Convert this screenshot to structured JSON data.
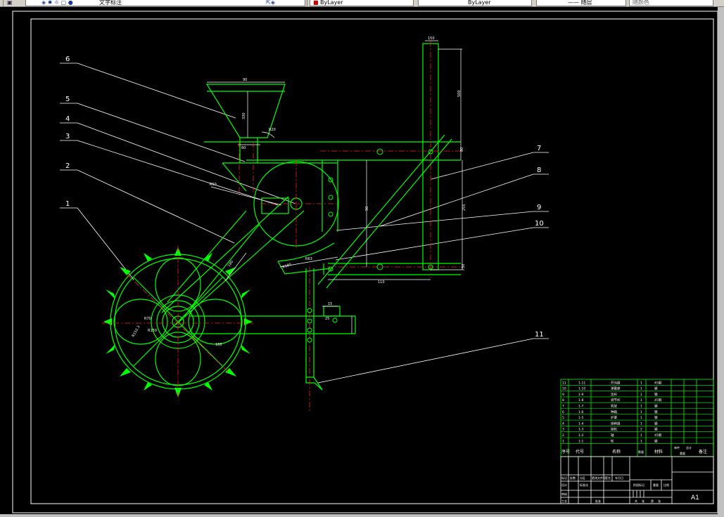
{
  "toolbar": {
    "layer_name": "文字标注",
    "layer_prefix": "0",
    "color_value": "ByLayer",
    "linetype_value": "ByLayer",
    "lineweight_value": "—— 随层",
    "plotstyle_value": "随颜色"
  },
  "drawing": {
    "callouts": [
      "6",
      "5",
      "4",
      "3",
      "2",
      "1",
      "7",
      "8",
      "9",
      "10",
      "11"
    ],
    "dimensions": [
      "90",
      "330",
      "60",
      "R20",
      "R50",
      "500",
      "150",
      "80",
      "50",
      "255",
      "110",
      "90",
      "15",
      "R63",
      "25",
      "R70",
      "R152.3",
      "160",
      "180",
      "R150",
      "R180"
    ],
    "sheet_size": "A1"
  },
  "bom": {
    "rows": [
      {
        "no": "11",
        "code": "1-11",
        "name": "开沟器",
        "qty": "1",
        "material": "45钢"
      },
      {
        "no": "10",
        "code": "1-10",
        "name": "弹簧座",
        "qty": "1",
        "material": "钢"
      },
      {
        "no": "9",
        "code": "1-9",
        "name": "连杆",
        "qty": "1",
        "material": "钢"
      },
      {
        "no": "8",
        "code": "1-8",
        "name": "调节杆",
        "qty": "1",
        "material": "45钢"
      },
      {
        "no": "7",
        "code": "1-7",
        "name": "机架",
        "qty": "1",
        "material": "钢"
      },
      {
        "no": "6",
        "code": "1-6",
        "name": "种箱",
        "qty": "1",
        "material": "钢"
      },
      {
        "no": "5",
        "code": "1-5",
        "name": "护罩",
        "qty": "1",
        "material": "钢"
      },
      {
        "no": "4",
        "code": "1-4",
        "name": "排种器",
        "qty": "1",
        "material": "钢"
      },
      {
        "no": "3",
        "code": "1-3",
        "name": "链轮",
        "qty": "2",
        "material": "钢"
      },
      {
        "no": "2",
        "code": "1-2",
        "name": "轴",
        "qty": "1",
        "material": "45钢"
      },
      {
        "no": "1",
        "code": "1-1",
        "name": "轮",
        "qty": "1",
        "material": "钢"
      }
    ],
    "header": {
      "no": "序号",
      "code": "代号",
      "name": "名称",
      "qty": "数量",
      "material": "材料",
      "unit": "单件",
      "total": "总计",
      "mass": "重量",
      "remark": "备注"
    }
  },
  "title_block": {
    "labels": [
      "标记",
      "处数",
      "分区",
      "更改文件号",
      "签名",
      "年月日",
      "设计",
      "标准化",
      "审核",
      "工艺",
      "批准",
      "阶段标记",
      "重量",
      "比例",
      "共",
      "张",
      "第",
      "张"
    ],
    "sheet": "A1"
  },
  "colors": {
    "outline": "#00ff00",
    "center": "#ff2020",
    "dimension": "#ffffff",
    "border": "#ffffff",
    "background": "#000000"
  }
}
